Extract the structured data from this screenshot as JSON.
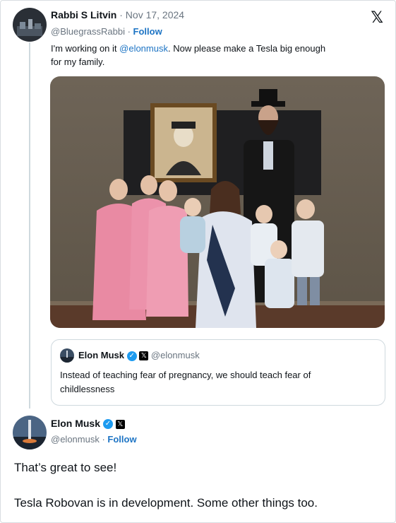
{
  "tweet1": {
    "name": "Rabbi S Litvin",
    "date": "Nov 17, 2024",
    "handle": "@BluegrassRabbi",
    "follow": "Follow",
    "text_before": "I'm working on it ",
    "mention": "@elonmusk",
    "text_after": ". Now please make a Tesla big enough",
    "text_line2": "for my family."
  },
  "quoted": {
    "name": "Elon Musk",
    "handle": "@elonmusk",
    "text_line1": "Instead of teaching fear of pregnancy, we should teach fear of",
    "text_line2": "childlessness"
  },
  "tweet2": {
    "name": "Elon Musk",
    "handle": "@elonmusk",
    "follow": "Follow",
    "text1": "That’s great to see!",
    "text2": "Tesla Robovan is in development. Some other things too."
  },
  "icons": {
    "x_logo": "𝕏",
    "verified": "✓",
    "x_badge": "𝕏"
  },
  "colors": {
    "link": "#1d74c4",
    "verified": "#1d9bf0"
  }
}
